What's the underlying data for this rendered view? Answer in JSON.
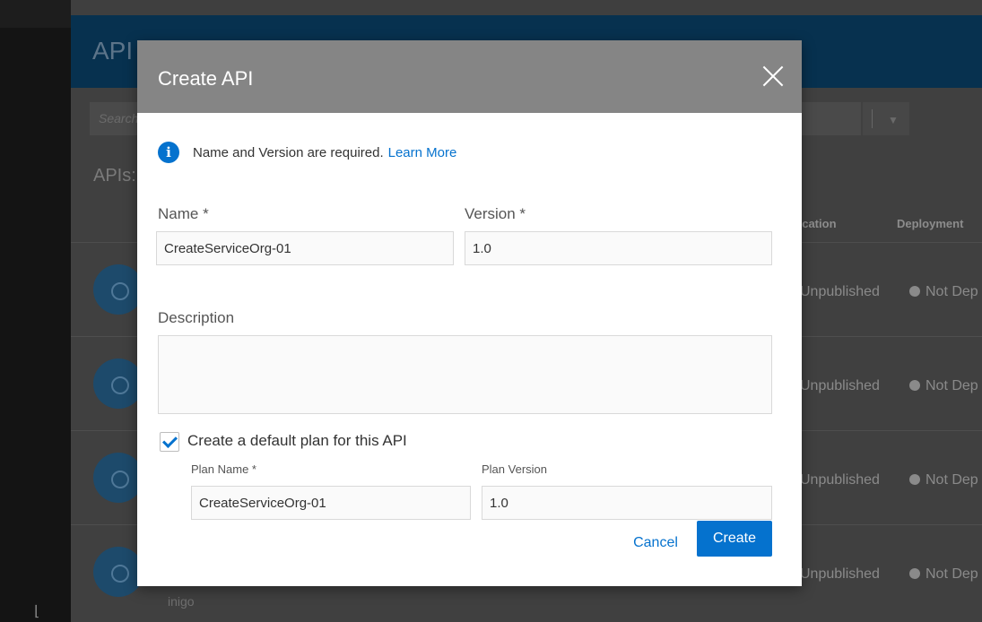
{
  "background": {
    "page_title": "API",
    "search_placeholder": "Search",
    "section_label": "APIs:",
    "columns": {
      "publication": "lication",
      "deployment": "Deployment"
    },
    "rows": [
      {
        "publication": "Unpublished",
        "deployment": "Not Dep"
      },
      {
        "publication": "Unpublished",
        "deployment": "Not Dep"
      },
      {
        "publication": "Unpublished",
        "deployment": "Not Dep"
      },
      {
        "publication": "Unpublished",
        "deployment": "Not Dep",
        "owner": "inigo"
      }
    ]
  },
  "modal": {
    "title": "Create API",
    "info_message": "Name and Version are required.",
    "info_link": "Learn More",
    "name_label": "Name *",
    "name_value": "CreateServiceOrg-01",
    "version_label": "Version *",
    "version_value": "1.0",
    "description_label": "Description",
    "description_value": "",
    "default_plan_checked": true,
    "default_plan_label": "Create a default plan for this API",
    "plan_name_label": "Plan Name *",
    "plan_name_value": "CreateServiceOrg-01",
    "plan_version_label": "Plan Version",
    "plan_version_value": "1.0",
    "cancel_label": "Cancel",
    "create_label": "Create"
  },
  "colors": {
    "accent": "#0572ce",
    "modal_header": "#858585",
    "app_header": "#07314f"
  },
  "icons": {
    "close": "close-icon",
    "info": "info-icon",
    "checkbox": "checkmark-icon",
    "api_avatar": "api-icon"
  }
}
